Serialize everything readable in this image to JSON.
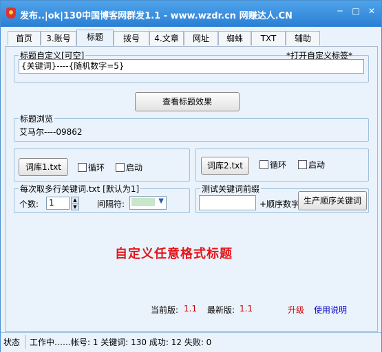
{
  "window": {
    "title": "发布..|ok|130中国博客网群发1.1 - www.wzdr.cn 网赚达人.CN",
    "minimize": "─",
    "maximize": "□",
    "close": "✕"
  },
  "tabs": [
    "首页",
    "3.账号",
    "标题",
    "拨号",
    "4.文章",
    "网址",
    "蜘蛛",
    "TXT",
    "辅助"
  ],
  "active_tab": "标题",
  "title_group": {
    "legend": "标题自定义[可空]",
    "open_custom_tag": "*打开自定义标签*",
    "value": "{关键词}----{随机数字=5}"
  },
  "preview_button": "查看标题效果",
  "preview_group": {
    "legend": "标题浏览",
    "text": "艾马尔----09862"
  },
  "lib1": {
    "button": "词库1.txt",
    "loop": "循环",
    "enable": "启动"
  },
  "lib2": {
    "button": "词库2.txt",
    "loop": "循环",
    "enable": "启动"
  },
  "multi_group": {
    "legend": "每次取多行关键词.txt [默认为1]",
    "count_label": "个数:",
    "count_value": "1",
    "separator_label": "间隔符:"
  },
  "prefix_group": {
    "legend": "测试关键词前缀",
    "suffix_label": "+顺序数字",
    "generate_button": "生产顺序关键词"
  },
  "banner": "自定义任意格式标题",
  "version": {
    "current_label": "当前版:",
    "current_value": "1.1",
    "latest_label": "最新版:",
    "latest_value": "1.1",
    "upgrade": "升级",
    "help": "使用说明"
  },
  "status": {
    "label": "状态",
    "text": "工作中……帐号: 1 关键词: 130 成功: 12 失败: 0"
  },
  "colors": {
    "accent_red": "#e4161b",
    "title_bar": "#2a7fd4",
    "separator_swatch": "#c8e6c9"
  }
}
